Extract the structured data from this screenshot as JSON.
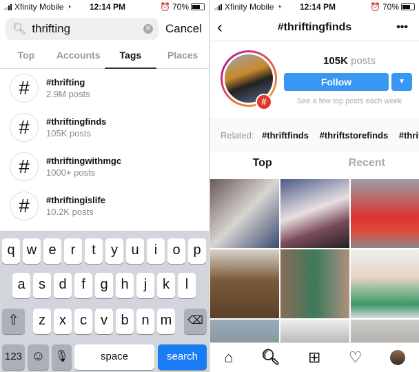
{
  "status": {
    "carrier": "Xfinity Mobile",
    "time": "12:14 PM",
    "battery": "70%",
    "battery_level": 0.7
  },
  "search": {
    "query": "thrifting",
    "cancel_label": "Cancel",
    "tabs": [
      {
        "label": "Top"
      },
      {
        "label": "Accounts"
      },
      {
        "label": "Tags",
        "active": true
      },
      {
        "label": "Places"
      }
    ],
    "results": [
      {
        "name": "#thrifting",
        "count": "2.9M posts"
      },
      {
        "name": "#thriftingfinds",
        "count": "105K posts"
      },
      {
        "name": "#thriftingwithmgc",
        "count": "1000+ posts"
      },
      {
        "name": "#thriftingislife",
        "count": "10.2K posts"
      }
    ]
  },
  "keyboard": {
    "row1": [
      "q",
      "w",
      "e",
      "r",
      "t",
      "y",
      "u",
      "i",
      "o",
      "p"
    ],
    "row2": [
      "a",
      "s",
      "d",
      "f",
      "g",
      "h",
      "j",
      "k",
      "l"
    ],
    "row3": [
      "z",
      "x",
      "c",
      "v",
      "b",
      "n",
      "m"
    ],
    "numbers_label": "123",
    "space_label": "space",
    "search_label": "search"
  },
  "hashtag_page": {
    "title": "#thriftingfinds",
    "post_count": "105K",
    "posts_label": "posts",
    "follow_label": "Follow",
    "subtext": "See a few top posts each week",
    "related_label": "Related:",
    "related": [
      "#thriftfinds",
      "#thriftstorefinds",
      "#thriftstore"
    ],
    "tabs": [
      {
        "label": "Top",
        "active": true
      },
      {
        "label": "Recent"
      }
    ],
    "accent": "#3897f0"
  }
}
